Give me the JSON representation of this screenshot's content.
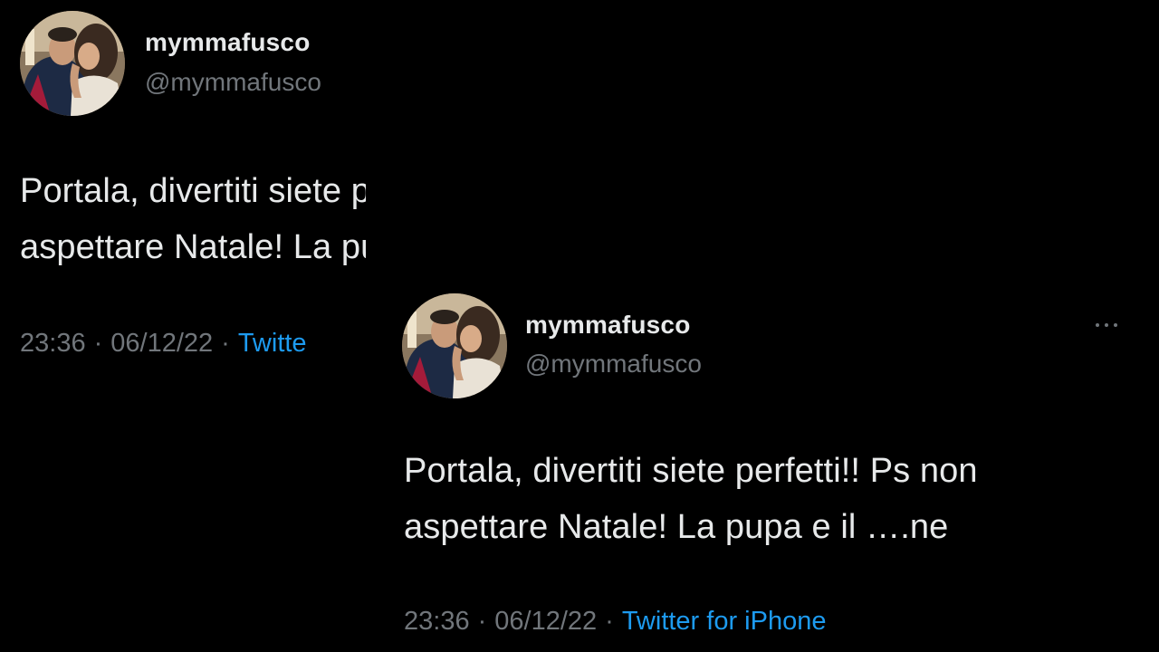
{
  "colors": {
    "background": "#000000",
    "text_primary": "#e7e9ea",
    "text_secondary": "#71767b",
    "link": "#1d9bf0"
  },
  "tweets": [
    {
      "author": {
        "display_name": "mymmafusco",
        "handle": "@mymmafusco"
      },
      "text_line_1": "Portala, divertiti siete perfetti!! Ps non",
      "text_line_2": "aspettare Natale! La pupa e il ….ne",
      "meta": {
        "time": "23:36",
        "separator_1": "·",
        "date": "06/12/22",
        "separator_2": "·",
        "source": "Twitte"
      },
      "icons": {
        "more": "more-horizontal-icon"
      }
    },
    {
      "author": {
        "display_name": "mymmafusco",
        "handle": "@mymmafusco"
      },
      "text_line_1": "Portala, divertiti siete perfetti!! Ps non",
      "text_line_2": "aspettare Natale! La pupa e il ….ne",
      "meta": {
        "time": "23:36",
        "separator_1": "·",
        "date": "06/12/22",
        "separator_2": "·",
        "source": "Twitter for iPhone"
      },
      "icons": {
        "more": "more-horizontal-icon"
      }
    }
  ]
}
